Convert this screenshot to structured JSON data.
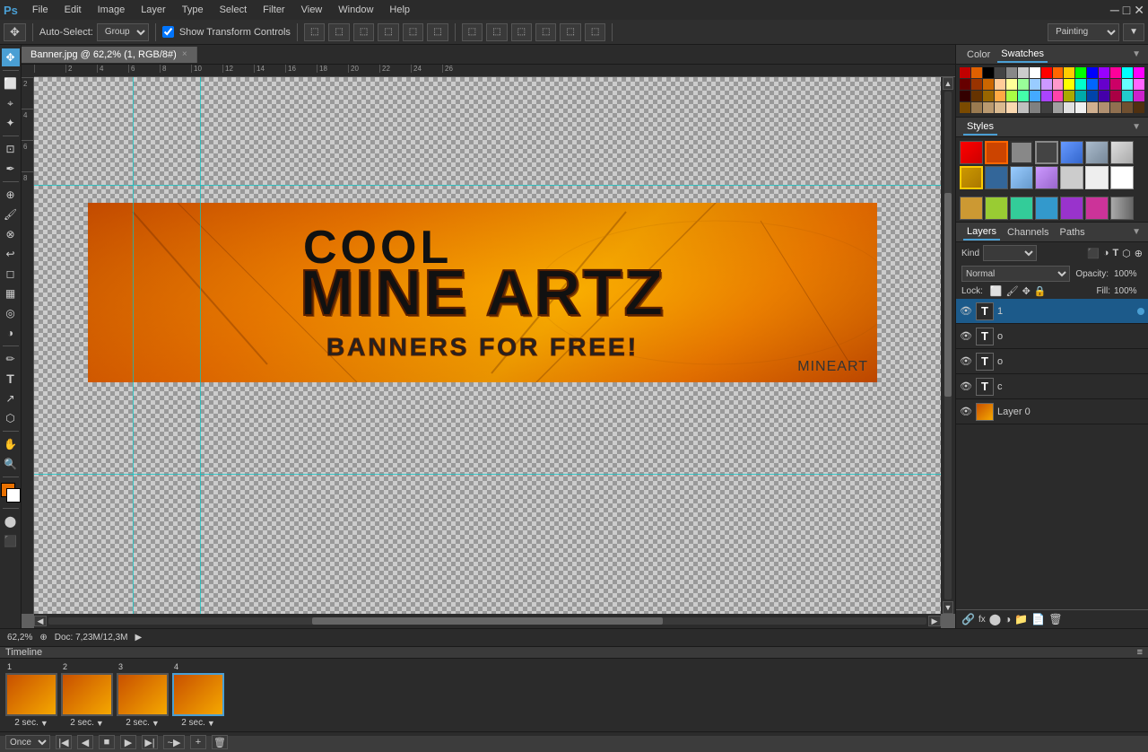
{
  "app": {
    "name": "PS",
    "title": "Banner.jpg @ 62,2% (1, RGB/8#)"
  },
  "menubar": {
    "items": [
      "Ps",
      "File",
      "Edit",
      "Image",
      "Layer",
      "Type",
      "Select",
      "Filter",
      "View",
      "Window",
      "Help"
    ]
  },
  "toolbar": {
    "autoselect_label": "Auto-Select:",
    "group_label": "Group",
    "show_transform": "Show Transform Controls",
    "painting_label": "Painting"
  },
  "tab": {
    "filename": "Banner.jpg @ 62,2% (1, RGB/8#)",
    "close": "×"
  },
  "canvas": {
    "zoom": "62,2%",
    "doc_info": "Doc: 7,23M/12,3M"
  },
  "banner": {
    "text_cool": "COOL",
    "text_mine": "MINE ARTZ",
    "text_banners": "BANNERS FOR FREE!",
    "watermark": "MINEART"
  },
  "color_panel": {
    "tab1": "Color",
    "tab2": "Swatches"
  },
  "styles_panel": {
    "title": "Styles"
  },
  "layers_panel": {
    "tab1": "Layers",
    "tab2": "Channels",
    "tab3": "Paths",
    "kind_label": "Kind",
    "blend_mode": "Normal",
    "opacity_label": "Opacity:",
    "opacity_val": "100%",
    "lock_label": "Lock:",
    "fill_label": "Fill:",
    "fill_val": "100%",
    "layers": [
      {
        "name": "1",
        "type": "text",
        "active": true,
        "dot": true
      },
      {
        "name": "o",
        "type": "text",
        "active": false,
        "dot": true
      },
      {
        "name": "o",
        "type": "text",
        "active": false,
        "dot": true
      },
      {
        "name": "c",
        "type": "text",
        "active": false,
        "dot": false
      },
      {
        "name": "Layer 0",
        "type": "image",
        "active": false,
        "dot": false
      }
    ]
  },
  "timeline": {
    "title": "Timeline",
    "frames": [
      {
        "id": "1",
        "delay": "2 sec.",
        "selected": false
      },
      {
        "id": "2",
        "delay": "2 sec.",
        "selected": false
      },
      {
        "id": "3",
        "delay": "2 sec.",
        "selected": false
      },
      {
        "id": "4",
        "delay": "2 sec.",
        "selected": true
      }
    ],
    "loop_label": "Once",
    "controls": [
      "first",
      "prev",
      "stop",
      "play",
      "next",
      "tween",
      "delete"
    ]
  },
  "ruler": {
    "h_ticks": [
      "",
      "2",
      "4",
      "6",
      "8",
      "10",
      "12",
      "14",
      "16",
      "18",
      "20",
      "22",
      "24",
      "26"
    ],
    "v_ticks": [
      "2",
      "4",
      "6",
      "8"
    ]
  }
}
